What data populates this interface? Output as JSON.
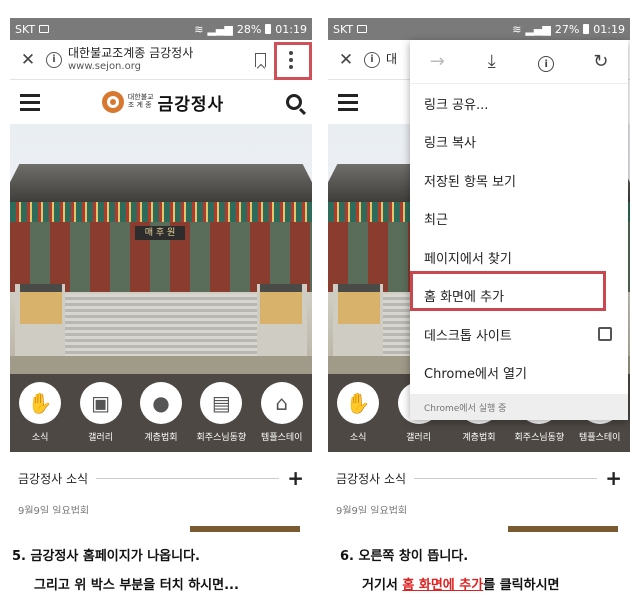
{
  "status_bar": {
    "carrier": "SKT",
    "left": {
      "battery": "28%",
      "time": "01:19"
    },
    "right": {
      "battery": "27%",
      "time": "01:19"
    }
  },
  "url_bar": {
    "page_title": "대한불교조계종 금강정사",
    "page_title_partial": "대",
    "url": "www.sejon.org"
  },
  "site": {
    "logo_small_line1": "대한불교",
    "logo_small_line2": "조 계 종",
    "logo_main": "금강정사",
    "hero_sign": "매 후 원"
  },
  "quick_menu": [
    {
      "label": "소식",
      "icon": "hands-icon"
    },
    {
      "label": "갤러리",
      "icon": "picture-icon"
    },
    {
      "label": "계층법회",
      "icon": "person-icon"
    },
    {
      "label": "회주스님동향",
      "icon": "book-icon"
    },
    {
      "label": "템플스테이",
      "icon": "temple-icon"
    }
  ],
  "news": {
    "title": "금강정사 소식",
    "cut_text": "9월9일 일요법회"
  },
  "chrome_menu": {
    "items": [
      "링크 공유...",
      "링크 복사",
      "저장된 항목 보기",
      "최근",
      "페이지에서 찾기",
      "홈 화면에 추가",
      "데스크톱 사이트",
      "Chrome에서 열기"
    ],
    "footer": "Chrome에서 실행 중"
  },
  "captions": {
    "left_line1": "5. 금강정사 홈페이지가 나옵니다.",
    "left_line2": "그리고 위 박스 부분을 터치 하시면...",
    "right_line1": "6. 오른쪽 창이 뜹니다.",
    "right_line2_pre": "거기서 ",
    "right_line2_highlight": "홈 화면에 추가",
    "right_line2_post": "를 클릭하시면"
  },
  "colors": {
    "highlight_box": "#d0505a",
    "quick_menu_bg": "#4d4843",
    "logo_orange": "#d87830",
    "caption_highlight": "#e02020"
  }
}
